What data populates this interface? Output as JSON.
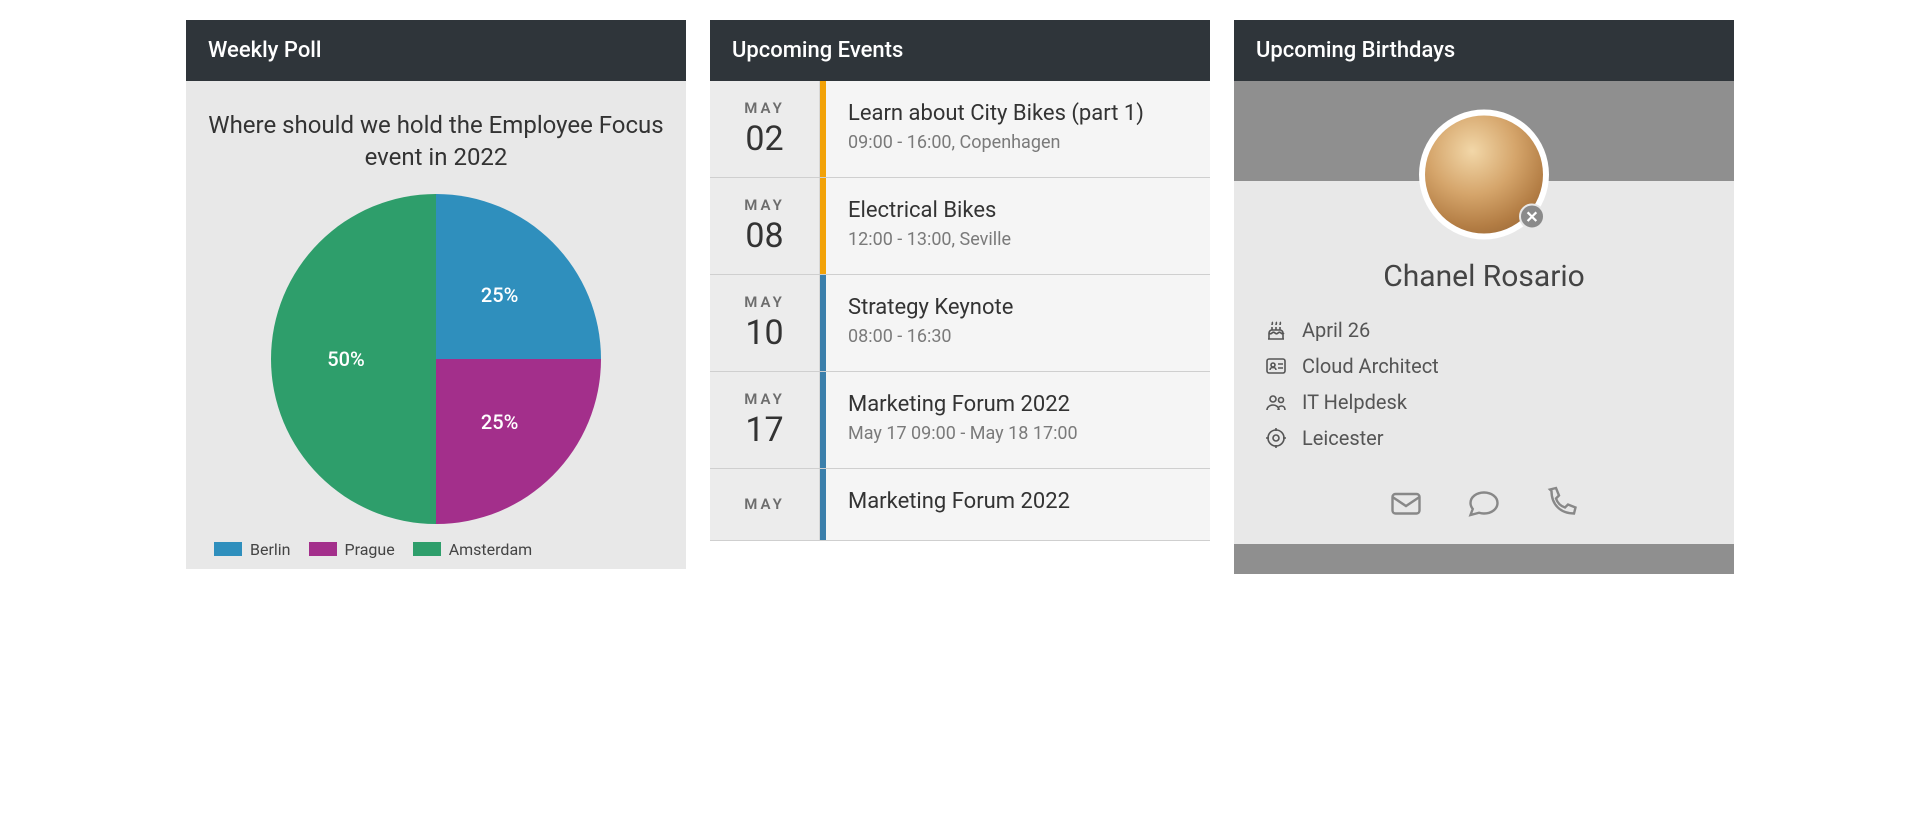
{
  "poll": {
    "header": "Weekly Poll",
    "question": "Where should we hold the Employee Focus event in 2022",
    "legend": [
      {
        "label": "Berlin",
        "color": "#2f8fbd"
      },
      {
        "label": "Prague",
        "color": "#a32f8b"
      },
      {
        "label": "Amsterdam",
        "color": "#2e9e6b"
      }
    ]
  },
  "events": {
    "header": "Upcoming Events",
    "items": [
      {
        "month": "MAY",
        "day": "02",
        "title": "Learn about City Bikes (part 1)",
        "meta": "09:00 - 16:00, Copenhagen",
        "color": "#f2a208"
      },
      {
        "month": "MAY",
        "day": "08",
        "title": "Electrical Bikes",
        "meta": "12:00 - 13:00, Seville",
        "color": "#f2a208"
      },
      {
        "month": "MAY",
        "day": "10",
        "title": "Strategy Keynote",
        "meta": "08:00 - 16:30",
        "color": "#3b7fab"
      },
      {
        "month": "MAY",
        "day": "17",
        "title": "Marketing Forum 2022",
        "meta": "May 17 09:00 - May 18 17:00",
        "color": "#3b7fab"
      },
      {
        "month": "MAY",
        "day": "",
        "title": "Marketing Forum 2022",
        "meta": "",
        "color": "#3b7fab"
      }
    ]
  },
  "birthday": {
    "header": "Upcoming Birthdays",
    "name": "Chanel Rosario",
    "date": "April 26",
    "role": "Cloud Architect",
    "team": "IT Helpdesk",
    "location": "Leicester"
  },
  "chart_data": {
    "type": "pie",
    "title": "Where should we hold the Employee Focus event in 2022",
    "series": [
      {
        "name": "Berlin",
        "value": 25,
        "label": "25%",
        "color": "#2f8fbd"
      },
      {
        "name": "Prague",
        "value": 25,
        "label": "25%",
        "color": "#a32f8b"
      },
      {
        "name": "Amsterdam",
        "value": 50,
        "label": "50%",
        "color": "#2e9e6b"
      }
    ]
  }
}
